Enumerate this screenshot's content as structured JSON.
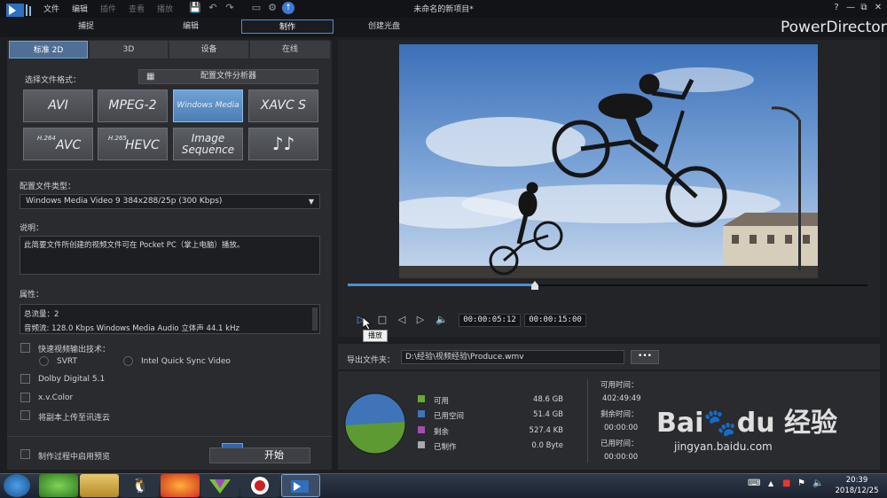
{
  "window": {
    "title": "未命名的新项目*",
    "brand": "PowerDirector",
    "menu": [
      "文件",
      "编辑",
      "插件",
      "查看",
      "播放"
    ],
    "win_buttons": [
      "?",
      "—",
      "⧉",
      "✕"
    ]
  },
  "main_tabs": [
    "捕捉",
    "编辑",
    "制作",
    "创建光盘"
  ],
  "sub_tabs": [
    "标准 2D",
    "3D",
    "设备",
    "在线"
  ],
  "format_section": {
    "label": "选择文件格式：",
    "config_button": "配置文件分析器",
    "formats": [
      {
        "label": "AVI",
        "sup": ""
      },
      {
        "label": "MPEG-2",
        "sup": ""
      },
      {
        "label": "Windows Media",
        "sup": ""
      },
      {
        "label": "XAVC S",
        "sup": ""
      },
      {
        "label": "AVC",
        "sup": "H.264"
      },
      {
        "label": "HEVC",
        "sup": "H.265"
      },
      {
        "label": "Image Sequence",
        "sup": ""
      },
      {
        "label": "♪♪",
        "sup": ""
      }
    ]
  },
  "profile": {
    "type_label": "配置文件类型：",
    "type_value": "Windows Media Video 9 384x288/25p (300 Kbps)",
    "desc_label": "说明：",
    "desc_value": "此简要文件所创建的视频文件可在 Pocket PC（掌上电脑）播放。",
    "props_label": "属性：",
    "props_line1": "总流量：2",
    "props_line2": "音频流:  128.0 Kbps  Windows Media Audio  立体声  44.1 kHz"
  },
  "options": {
    "fast_label": "快速视频输出技术：",
    "svrt": "SVRT",
    "intel": "Intel Quick Sync Video",
    "dolby": "Dolby Digital 5.1",
    "xvcolor": "x.v.Color",
    "upload": "将副本上传至讯连云",
    "preview": "制作过程中启用预览",
    "start": "开始"
  },
  "player": {
    "current_time": "00:00:05:12",
    "total_time": "00:00:15:00",
    "tooltip": "播放",
    "progress": 0.36
  },
  "export": {
    "folder_label": "导出文件夹：",
    "path": "D:\\经验\\视频经验\\Produce.wmv",
    "browse": "•••"
  },
  "disk": {
    "items": [
      {
        "label": "可用",
        "value": "48.6  GB",
        "color": "#6aa834"
      },
      {
        "label": "已用空间",
        "value": "51.4  GB",
        "color": "#3f74b8"
      },
      {
        "label": "剩余",
        "value": "527.4  KB",
        "color": "#a24fb0"
      },
      {
        "label": "已制作",
        "value": "0.0  Byte",
        "color": "#a7a9ac"
      }
    ],
    "available_time_label": "可用时间：",
    "available_time": "402:49:49",
    "remaining_time_label": "剩余时间：",
    "remaining_time": "00:00:00",
    "used_time_label": "已用时间：",
    "used_time": "00:00:00"
  },
  "taskbar": {
    "time": "20:39",
    "date": "2018/12/25"
  },
  "watermark": {
    "text": "Bai du 经验",
    "url": "jingyan.baidu.com"
  }
}
